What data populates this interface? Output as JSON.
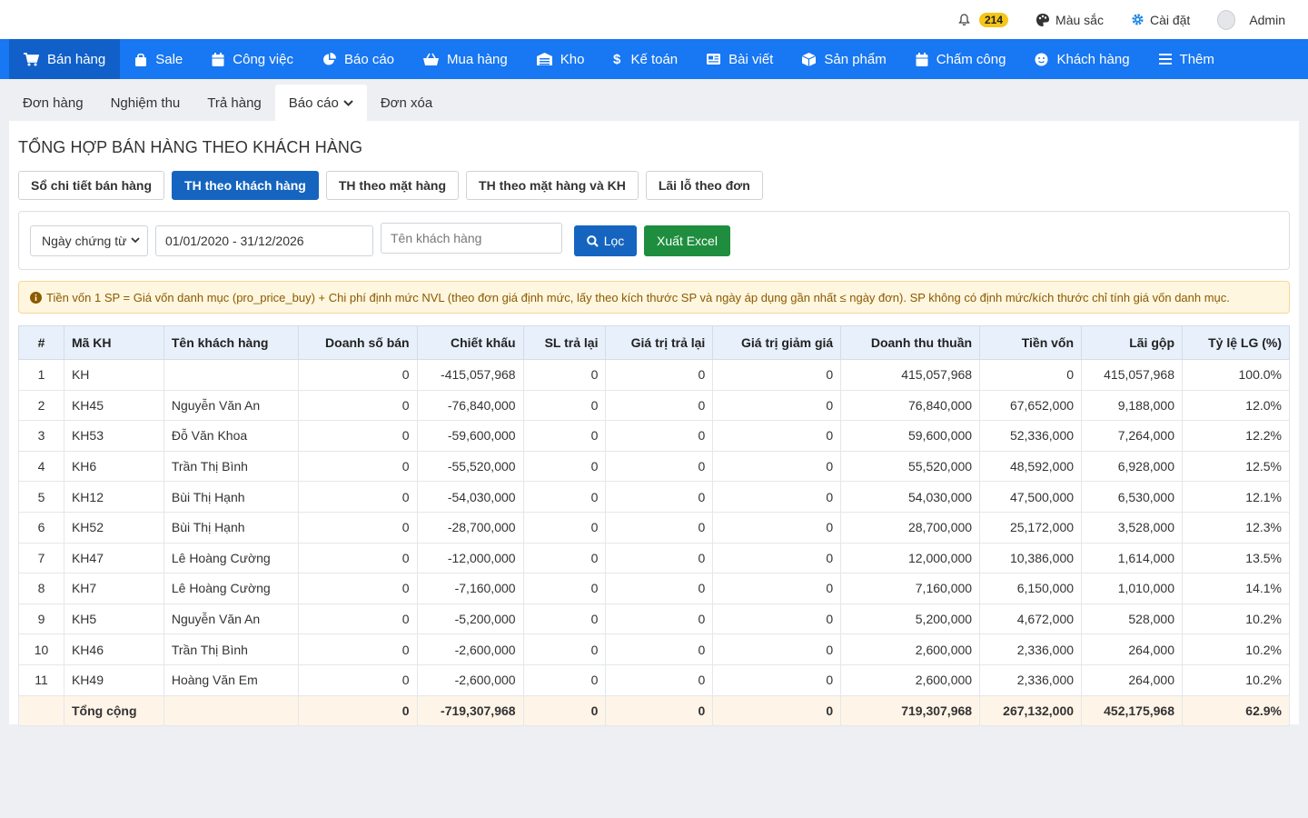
{
  "topbar": {
    "notif_count": "214",
    "color_label": "Màu sắc",
    "settings_label": "Cài đặt",
    "user_name": "Admin"
  },
  "nav": [
    {
      "label": "Bán hàng",
      "icon": "cart-icon"
    },
    {
      "label": "Sale",
      "icon": "shopping-bag-icon"
    },
    {
      "label": "Công việc",
      "icon": "calendar-icon"
    },
    {
      "label": "Báo cáo",
      "icon": "pie-chart-icon"
    },
    {
      "label": "Mua hàng",
      "icon": "basket-icon"
    },
    {
      "label": "Kho",
      "icon": "warehouse-icon"
    },
    {
      "label": "Kế toán",
      "icon": "dollar-icon"
    },
    {
      "label": "Bài viết",
      "icon": "newspaper-icon"
    },
    {
      "label": "Sản phẩm",
      "icon": "box-icon"
    },
    {
      "label": "Chấm công",
      "icon": "calendar-check-icon"
    },
    {
      "label": "Khách hàng",
      "icon": "smile-icon"
    },
    {
      "label": "Thêm",
      "icon": "menu-icon"
    }
  ],
  "subtabs": [
    "Đơn hàng",
    "Nghiệm thu",
    "Trả hàng",
    "Báo cáo",
    "Đơn xóa"
  ],
  "page_title": "TỔNG HỢP BÁN HÀNG THEO KHÁCH HÀNG",
  "report_tabs": [
    "Sổ chi tiết bán hàng",
    "TH theo khách hàng",
    "TH theo mặt hàng",
    "TH theo mặt hàng và KH",
    "Lãi lỗ theo đơn"
  ],
  "filter": {
    "date_type": "Ngày chứng từ",
    "date_range": "01/01/2020 - 31/12/2026",
    "customer_placeholder": "Tên khách hàng",
    "filter_label": "Lọc",
    "excel_label": "Xuất Excel"
  },
  "note": "Tiền vốn 1 SP = Giá vốn danh mục (pro_price_buy) + Chi phí định mức NVL (theo đơn giá định mức, lấy theo kích thước SP và ngày áp dụng gần nhất ≤ ngày đơn). SP không có định mức/kích thước chỉ tính giá vốn danh mục.",
  "table": {
    "headers": [
      "#",
      "Mã KH",
      "Tên khách hàng",
      "Doanh số bán",
      "Chiết khấu",
      "SL trả lại",
      "Giá trị trả lại",
      "Giá trị giảm giá",
      "Doanh thu thuần",
      "Tiền vốn",
      "Lãi gộp",
      "Tỷ lệ LG (%)"
    ],
    "rows": [
      [
        "1",
        "KH",
        "",
        "0",
        "-415,057,968",
        "0",
        "0",
        "0",
        "415,057,968",
        "0",
        "415,057,968",
        "100.0%"
      ],
      [
        "2",
        "KH45",
        "Nguyễn Văn An",
        "0",
        "-76,840,000",
        "0",
        "0",
        "0",
        "76,840,000",
        "67,652,000",
        "9,188,000",
        "12.0%"
      ],
      [
        "3",
        "KH53",
        "Đỗ Văn Khoa",
        "0",
        "-59,600,000",
        "0",
        "0",
        "0",
        "59,600,000",
        "52,336,000",
        "7,264,000",
        "12.2%"
      ],
      [
        "4",
        "KH6",
        "Trần Thị Bình",
        "0",
        "-55,520,000",
        "0",
        "0",
        "0",
        "55,520,000",
        "48,592,000",
        "6,928,000",
        "12.5%"
      ],
      [
        "5",
        "KH12",
        "Bùi Thị Hạnh",
        "0",
        "-54,030,000",
        "0",
        "0",
        "0",
        "54,030,000",
        "47,500,000",
        "6,530,000",
        "12.1%"
      ],
      [
        "6",
        "KH52",
        "Bùi Thị Hạnh",
        "0",
        "-28,700,000",
        "0",
        "0",
        "0",
        "28,700,000",
        "25,172,000",
        "3,528,000",
        "12.3%"
      ],
      [
        "7",
        "KH47",
        "Lê Hoàng Cường",
        "0",
        "-12,000,000",
        "0",
        "0",
        "0",
        "12,000,000",
        "10,386,000",
        "1,614,000",
        "13.5%"
      ],
      [
        "8",
        "KH7",
        "Lê Hoàng Cường",
        "0",
        "-7,160,000",
        "0",
        "0",
        "0",
        "7,160,000",
        "6,150,000",
        "1,010,000",
        "14.1%"
      ],
      [
        "9",
        "KH5",
        "Nguyễn Văn An",
        "0",
        "-5,200,000",
        "0",
        "0",
        "0",
        "5,200,000",
        "4,672,000",
        "528,000",
        "10.2%"
      ],
      [
        "10",
        "KH46",
        "Trần Thị Bình",
        "0",
        "-2,600,000",
        "0",
        "0",
        "0",
        "2,600,000",
        "2,336,000",
        "264,000",
        "10.2%"
      ],
      [
        "11",
        "KH49",
        "Hoàng Văn Em",
        "0",
        "-2,600,000",
        "0",
        "0",
        "0",
        "2,600,000",
        "2,336,000",
        "264,000",
        "10.2%"
      ]
    ],
    "total": [
      "",
      "Tổng cộng",
      "",
      "0",
      "-719,307,968",
      "0",
      "0",
      "0",
      "719,307,968",
      "267,132,000",
      "452,175,968",
      "62.9%"
    ]
  },
  "colors": {
    "nav_bg": "#1877f2",
    "active_tab": "#1565c0",
    "excel": "#1e8e3e",
    "badge": "#f5c518"
  }
}
